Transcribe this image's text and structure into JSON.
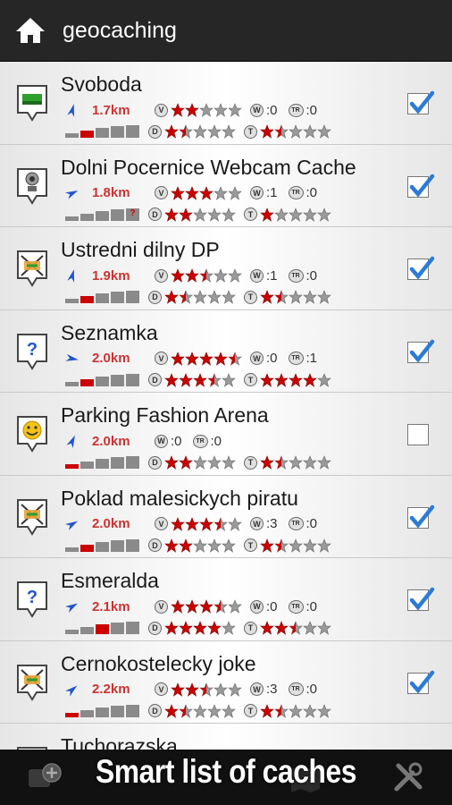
{
  "header": {
    "title": "geocaching",
    "home_icon": "home-icon"
  },
  "caches": [
    {
      "name": "Svoboda",
      "type_icon": "traditional-cache-icon",
      "bearing_deg": 15,
      "distance": "1.7km",
      "has_votes": true,
      "votes_rating": 2,
      "w": ":0",
      "tr": ":0",
      "size": 2,
      "difficulty": 1.5,
      "terrain": 1.5,
      "checked": true
    },
    {
      "name": "Dolni Pocernice Webcam Cache",
      "type_icon": "webcam-cache-icon",
      "bearing_deg": 65,
      "distance": "1.8km",
      "has_votes": true,
      "votes_rating": 3,
      "w": ":1",
      "tr": ":0",
      "size": "?",
      "difficulty": 2,
      "terrain": 1,
      "checked": true
    },
    {
      "name": "Ustredni dilny DP",
      "type_icon": "multi-cache-icon",
      "bearing_deg": 15,
      "distance": "1.9km",
      "has_votes": true,
      "votes_rating": 2.5,
      "w": ":1",
      "tr": ":0",
      "size": 2,
      "difficulty": 1.5,
      "terrain": 1.5,
      "checked": true
    },
    {
      "name": "Seznamka",
      "type_icon": "mystery-cache-icon",
      "bearing_deg": 100,
      "distance": "2.0km",
      "has_votes": true,
      "votes_rating": 4.5,
      "w": ":0",
      "tr": ":1",
      "size": 2,
      "difficulty": 3.5,
      "terrain": 4,
      "checked": true
    },
    {
      "name": "Parking Fashion Arena",
      "type_icon": "event-cache-icon",
      "bearing_deg": 25,
      "distance": "2.0km",
      "has_votes": false,
      "w": ":0",
      "tr": ":0",
      "size": 1,
      "difficulty": 2,
      "terrain": 1.5,
      "checked": false
    },
    {
      "name": "Poklad malesickych piratu",
      "type_icon": "multi-cache-icon",
      "bearing_deg": 60,
      "distance": "2.0km",
      "has_votes": true,
      "votes_rating": 3.5,
      "w": ":3",
      "tr": ":0",
      "size": 2,
      "difficulty": 2,
      "terrain": 1.5,
      "checked": true
    },
    {
      "name": "Esmeralda",
      "type_icon": "mystery-cache-icon",
      "bearing_deg": 60,
      "distance": "2.1km",
      "has_votes": true,
      "votes_rating": 3.5,
      "w": ":0",
      "tr": ":0",
      "size": 3,
      "difficulty": 4,
      "terrain": 2.5,
      "checked": true
    },
    {
      "name": "Cernokostelecky joke",
      "type_icon": "multi-cache-icon",
      "bearing_deg": 50,
      "distance": "2.2km",
      "has_votes": true,
      "votes_rating": 2.5,
      "w": ":3",
      "tr": ":0",
      "size": 1,
      "difficulty": 1.5,
      "terrain": 1.5,
      "checked": true
    },
    {
      "name": "Tuchorazska",
      "type_icon": "traditional-cache-icon",
      "partial": true
    }
  ],
  "bottom_bar": {
    "caption": "Smart list of caches",
    "left_icon": "add-cache-icon",
    "mid_icon": "map-icon",
    "right_icon": "tools-icon"
  },
  "colors": {
    "topbar": "#262626",
    "distance": "#cc3333",
    "star_on": "#cc0000",
    "star_off": "#9a9a9a",
    "check": "#2c7bd6",
    "arrow": "#2456c9"
  }
}
